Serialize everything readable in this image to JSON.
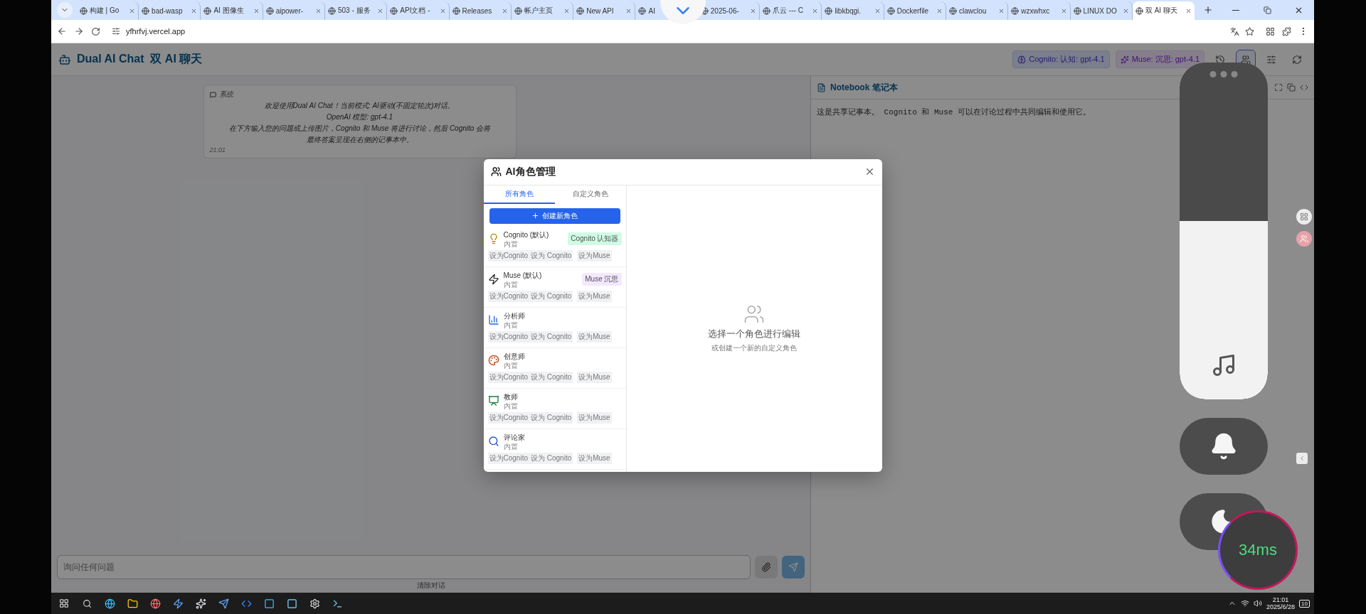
{
  "browser": {
    "tabs": [
      {
        "title": "构建 | Go",
        "selected": false
      },
      {
        "title": "bad-wasp",
        "selected": false
      },
      {
        "title": "AI 图像生",
        "selected": false
      },
      {
        "title": "aipower-",
        "selected": false
      },
      {
        "title": "503 - 服务",
        "selected": false
      },
      {
        "title": "API文档 -",
        "selected": false
      },
      {
        "title": "Releases",
        "selected": false
      },
      {
        "title": "帐户主页",
        "selected": false
      },
      {
        "title": "New API",
        "selected": false
      },
      {
        "title": "AI",
        "selected": false
      },
      {
        "title": "2025-06-",
        "selected": false
      },
      {
        "title": "爪云 --- C",
        "selected": false
      },
      {
        "title": "libkbqgi.",
        "selected": false
      },
      {
        "title": "Dockerfile",
        "selected": false
      },
      {
        "title": "clawclou",
        "selected": false
      },
      {
        "title": "wzxwhxc",
        "selected": false
      },
      {
        "title": "LINUX DO",
        "selected": false
      },
      {
        "title": "双 AI 聊天",
        "selected": true
      }
    ],
    "address": "yfhrfvj.vercel.app"
  },
  "app": {
    "title": "Dual AI Chat  双 AI 聊天",
    "model_chips": [
      {
        "label": "Cognito: 认知: gpt-4.1",
        "kind": "cognito"
      },
      {
        "label": "Muse: 沉思: gpt-4.1",
        "kind": "muse"
      }
    ],
    "toolbar": [
      {
        "kind": "history",
        "selected": false
      },
      {
        "kind": "roles",
        "selected": true
      },
      {
        "kind": "settings",
        "selected": false
      },
      {
        "kind": "reset",
        "selected": false
      }
    ],
    "system_message": {
      "sender": "系统",
      "lines": [
        "欢迎使用Dual AI Chat！当前模式: AI驱动(不固定轮次)对话。",
        "OpenAI 模型: gpt-4.1",
        "在下方输入您的问题或上传图片，Cognito 和 Muse 将进行讨论，然后 Cognito 会将",
        "最终答案呈现在右侧的记事本中。"
      ],
      "time": "21:01"
    },
    "notebook": {
      "title": "Notebook 笔记本",
      "text": "这是共享记事本。 Cognito 和 Muse 可以在讨论过程中共同编辑和使用它。"
    },
    "input": {
      "placeholder": "询问任何问题"
    },
    "clear_button": "清除对话"
  },
  "modal": {
    "title": "AI角色管理",
    "tabs": [
      {
        "label": "所有角色",
        "selected": true
      },
      {
        "label": "自定义角色",
        "selected": false
      }
    ],
    "create_button": "创建新角色",
    "roles": [
      {
        "name": "Cognito (默认)",
        "source": "内置",
        "badge": {
          "label": "Cognito 认知器",
          "color": "#d1fae5"
        },
        "actions": [
          "设为Cognito",
          "设为 Cognito",
          "设为Muse"
        ]
      },
      {
        "name": "Muse (默认)",
        "source": "内置",
        "badge": {
          "label": "Muse 沉思",
          "color": "#f3e8ff"
        },
        "actions": [
          "设为Cognito",
          "设为 Cognito",
          "设为Muse"
        ]
      },
      {
        "name": "分析师",
        "source": "内置",
        "actions": [
          "设为Cognito",
          "设为 Cognito",
          "设为Muse"
        ]
      },
      {
        "name": "创意师",
        "source": "内置",
        "actions": [
          "设为Cognito",
          "设为 Cognito",
          "设为Muse"
        ]
      },
      {
        "name": "教师",
        "source": "内置",
        "actions": [
          "设为Cognito",
          "设为 Cognito",
          "设为Muse"
        ]
      },
      {
        "name": "评论家",
        "source": "内置",
        "actions": [
          "设为Cognito",
          "设为 Cognito",
          "设为Muse"
        ]
      }
    ],
    "empty": {
      "title": "选择一个角色进行编辑",
      "hint": "或创建一个新的自定义角色"
    }
  },
  "overlay": {
    "volume": {
      "level": 0.53
    },
    "latency": "34ms"
  },
  "taskbar": {
    "time": "21:01",
    "date": "2025/6/28",
    "notifications": "10"
  }
}
